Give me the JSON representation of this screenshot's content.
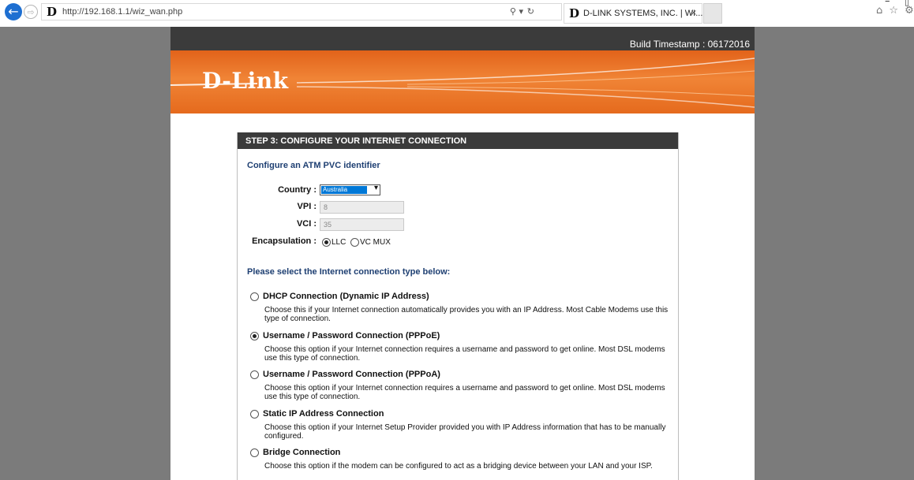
{
  "browser": {
    "url": "http://192.168.1.1/wiz_wan.php",
    "search_glyph": "⚲ ▾",
    "refresh_glyph": "↻",
    "tab_title": "D-LINK SYSTEMS, INC. | WI...",
    "tab_close": "×",
    "favicon_letter": "D",
    "back_glyph": "←",
    "forward_glyph": "⇨",
    "minimize_glyph": "–",
    "maximize_glyph": "▯",
    "tool_icons": "⌂ ☆ ⚙"
  },
  "header": {
    "build_timestamp": "Build Timestamp : 06172016",
    "logo_text": "D-Link",
    "brand_color": "#e8691f"
  },
  "wizard": {
    "title": "STEP 3: CONFIGURE YOUR INTERNET CONNECTION",
    "atm_heading": "Configure an ATM PVC identifier",
    "country_label": "Country :",
    "country_value": "Australia",
    "country_arrow": "▾",
    "vpi_label": "VPI :",
    "vpi_value": "8",
    "vci_label": "VCI :",
    "vci_value": "35",
    "encap_label": "Encapsulation :",
    "encap_options": [
      "LLC",
      "VC MUX"
    ],
    "encap_selected": "LLC",
    "conn_heading": "Please select the Internet connection type below:",
    "options": [
      {
        "title": "DHCP Connection (Dynamic IP Address)",
        "desc": "Choose this if your Internet connection automatically provides you with an IP Address. Most Cable Modems use this type of connection.",
        "selected": false
      },
      {
        "title": "Username / Password Connection (PPPoE)",
        "desc": "Choose this option if your Internet connection requires a username and password to get online. Most DSL modems use this type of connection.",
        "selected": true
      },
      {
        "title": "Username / Password Connection (PPPoA)",
        "desc": "Choose this option if your Internet connection requires a username and password to get online. Most DSL modems use this type of connection.",
        "selected": false
      },
      {
        "title": "Static IP Address Connection",
        "desc": "Choose this option if your Internet Setup Provider provided you with IP Address information that has to be manually configured.",
        "selected": false
      },
      {
        "title": "Bridge Connection",
        "desc": "Choose this option if the modem can be configured to act as a bridging device between your LAN and your ISP.",
        "selected": false
      }
    ]
  }
}
